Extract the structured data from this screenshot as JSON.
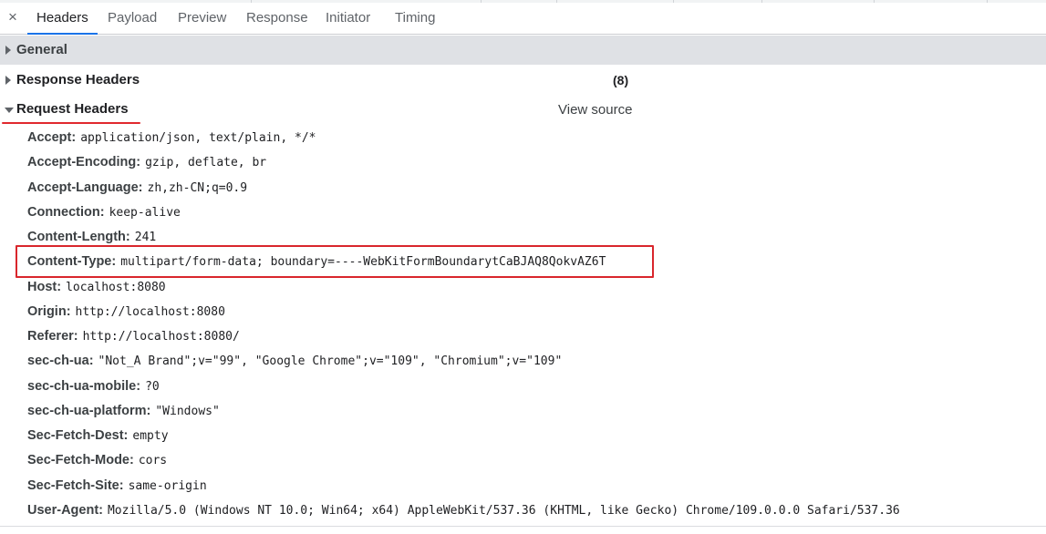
{
  "tabs": {
    "close_symbol": "×",
    "items": [
      {
        "label": "Headers",
        "active": true
      },
      {
        "label": "Payload",
        "active": false
      },
      {
        "label": "Preview",
        "active": false
      },
      {
        "label": "Response",
        "active": false
      },
      {
        "label": "Initiator",
        "active": false
      },
      {
        "label": "Timing",
        "active": false
      }
    ]
  },
  "sections": {
    "general": {
      "title": "General",
      "expanded": false
    },
    "response_headers": {
      "title": "Response Headers",
      "count": "(8)",
      "expanded": false
    },
    "request_headers": {
      "title": "Request Headers",
      "view_source": "View source",
      "expanded": true
    }
  },
  "request_headers": [
    {
      "name": "Accept:",
      "value": "application/json, text/plain, */*"
    },
    {
      "name": "Accept-Encoding:",
      "value": "gzip, deflate, br"
    },
    {
      "name": "Accept-Language:",
      "value": "zh,zh-CN;q=0.9"
    },
    {
      "name": "Connection:",
      "value": "keep-alive"
    },
    {
      "name": "Content-Length:",
      "value": "241"
    },
    {
      "name": "Content-Type:",
      "value": "multipart/form-data; boundary=----WebKitFormBoundarytCaBJAQ8QokvAZ6T",
      "highlighted": true
    },
    {
      "name": "Host:",
      "value": "localhost:8080"
    },
    {
      "name": "Origin:",
      "value": "http://localhost:8080"
    },
    {
      "name": "Referer:",
      "value": "http://localhost:8080/"
    },
    {
      "name": "sec-ch-ua:",
      "value": "\"Not_A Brand\";v=\"99\", \"Google Chrome\";v=\"109\", \"Chromium\";v=\"109\""
    },
    {
      "name": "sec-ch-ua-mobile:",
      "value": "?0"
    },
    {
      "name": "sec-ch-ua-platform:",
      "value": "\"Windows\""
    },
    {
      "name": "Sec-Fetch-Dest:",
      "value": "empty"
    },
    {
      "name": "Sec-Fetch-Mode:",
      "value": "cors"
    },
    {
      "name": "Sec-Fetch-Site:",
      "value": "same-origin"
    },
    {
      "name": "User-Agent:",
      "value": "Mozilla/5.0 (Windows NT 10.0; Win64; x64) AppleWebKit/537.36 (KHTML, like Gecko) Chrome/109.0.0.0 Safari/537.36"
    }
  ],
  "colors": {
    "active_tab_indicator": "#1a73e8",
    "annotation_red": "#e0282e",
    "general_bar": "#dfe1e5"
  }
}
